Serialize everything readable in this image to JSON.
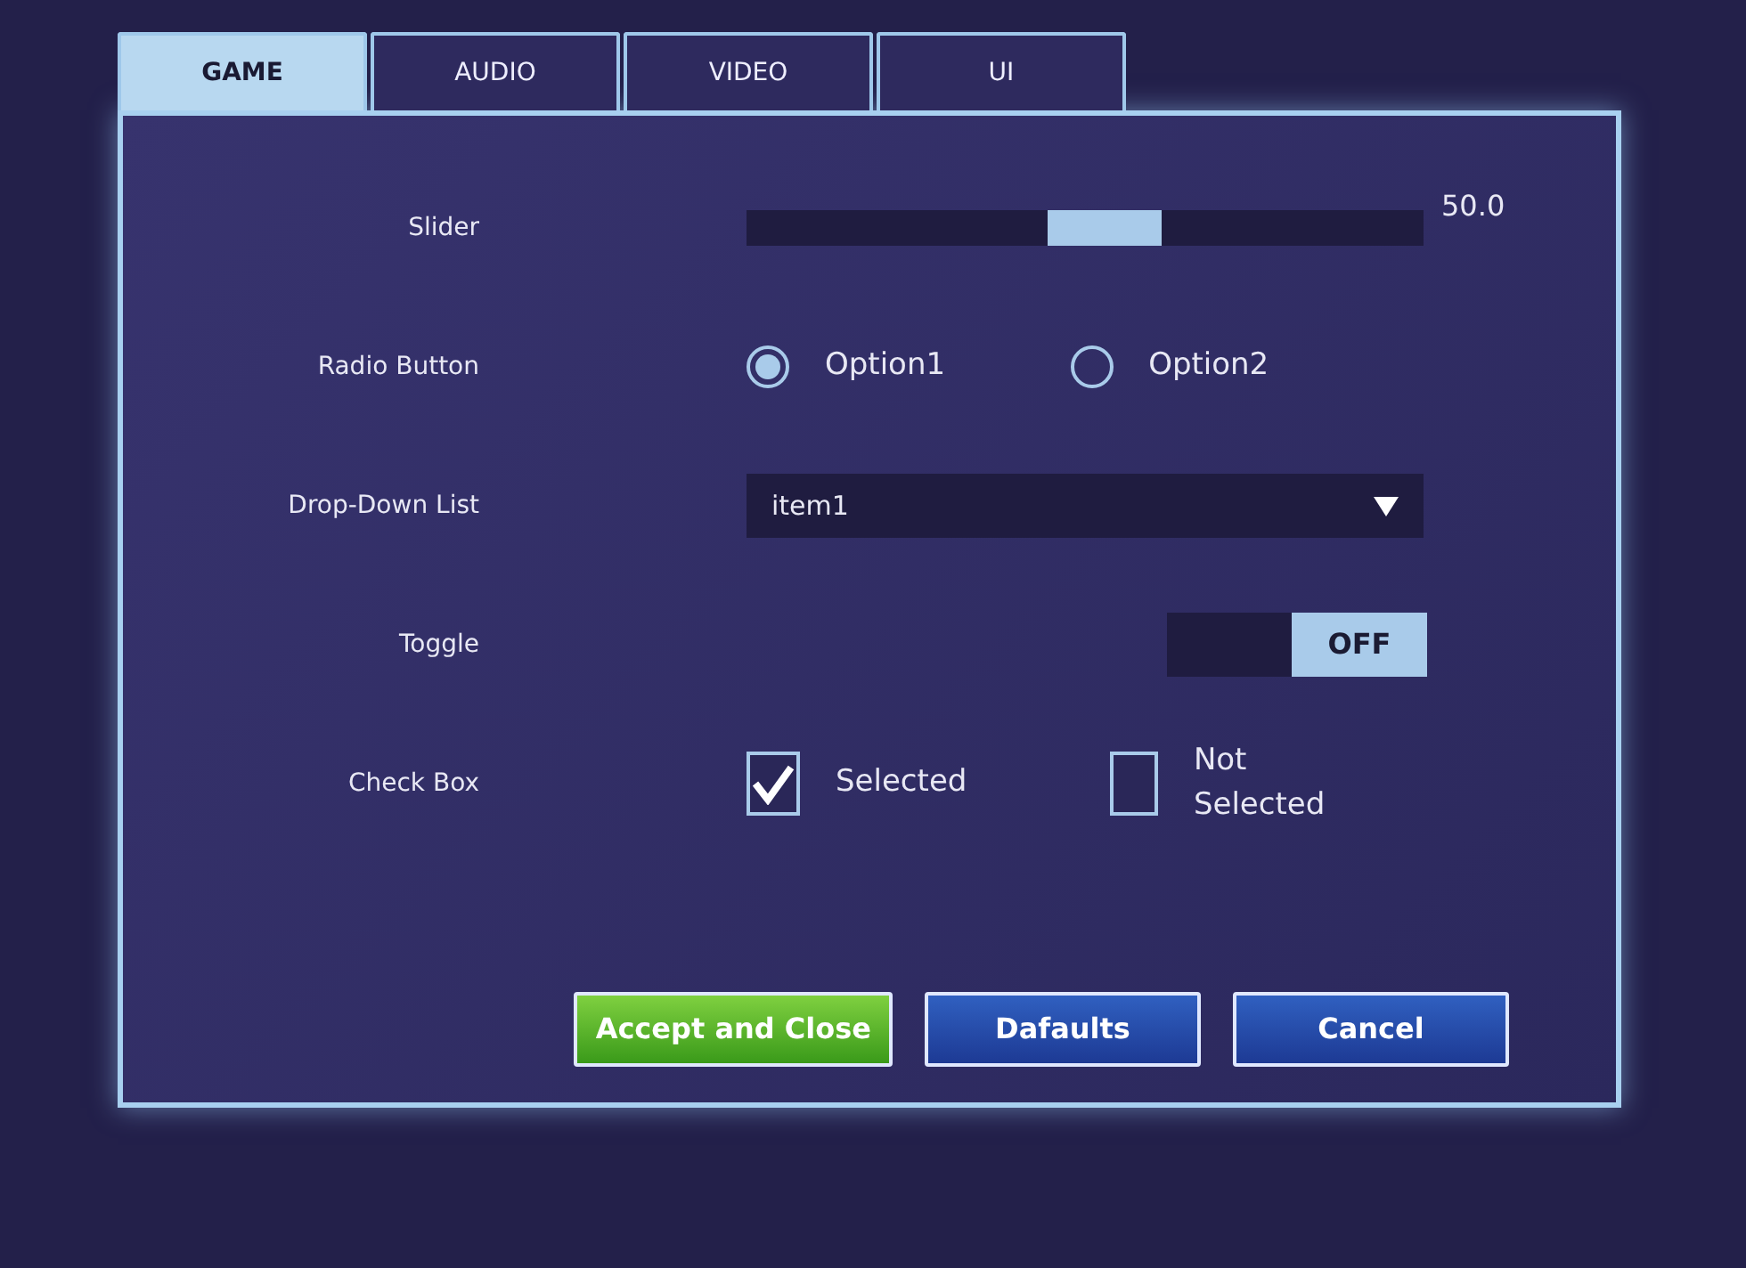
{
  "tabs": [
    {
      "label": "GAME",
      "selected": true
    },
    {
      "label": "AUDIO",
      "selected": false
    },
    {
      "label": "VIDEO",
      "selected": false
    },
    {
      "label": "UI",
      "selected": false
    }
  ],
  "rows": [
    {
      "kind": "slider",
      "label": "Slider",
      "level": 0.53,
      "reading": "50.0"
    },
    {
      "kind": "radio",
      "label": "Radio Button",
      "options": [
        {
          "label": "Option1",
          "selected": true
        },
        {
          "label": "Option2",
          "selected": false
        }
      ]
    },
    {
      "kind": "dropdown",
      "label": "Drop-Down List",
      "value": "item1"
    },
    {
      "kind": "toggle",
      "label": "Toggle",
      "on": false,
      "state_text": "OFF"
    },
    {
      "kind": "checkbox",
      "label": "Check Box",
      "options": [
        {
          "label": "Selected",
          "checked": true
        },
        {
          "label": "Not Selected",
          "checked": false
        }
      ]
    }
  ],
  "buttons": [
    {
      "label": "Accept and Close",
      "kind": "accept"
    },
    {
      "label": "Dafaults",
      "kind": "secondary"
    },
    {
      "label": "Cancel",
      "kind": "secondary"
    }
  ]
}
